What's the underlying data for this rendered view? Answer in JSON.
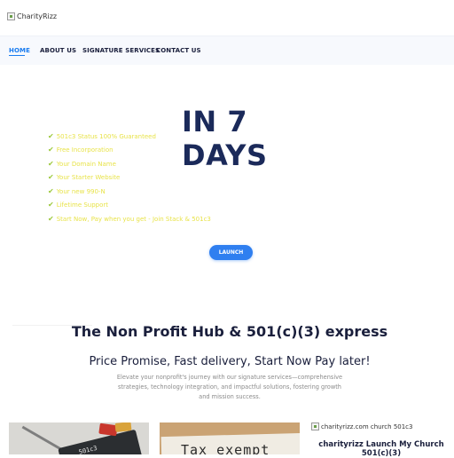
{
  "logo": {
    "alt": "CharityRizz"
  },
  "nav": {
    "items": [
      {
        "label": "HOME",
        "active": true
      },
      {
        "label": "ABOUT US",
        "active": false
      },
      {
        "label": "SIGNATURE SERVICES",
        "active": false
      },
      {
        "label": "CONTACT US",
        "active": false
      }
    ]
  },
  "hero": {
    "title_line1": "IN 7",
    "title_line2": "DAYS",
    "checklist": [
      "501c3 Status 100% Guaranteed",
      "Free Incorporation",
      "Your Domain Name",
      "Your Starter Website",
      "Your new 990-N",
      "Lifetime Support",
      "Start Now, Pay when you get - Join Stack & 501c3"
    ],
    "button_label": "LAUNCH"
  },
  "section": {
    "title": "The Non Profit Hub & 501(c)(3) express",
    "subtitle": "Price Promise, Fast delivery, Start Now Pay later!",
    "description": "Elevate your nonprofit's journey with our signature services—comprehensive strategies, technology integration, and impactful solutions, fostering growth and mission success."
  },
  "cards": {
    "card1_text": "501c3",
    "card2_text": "Tax exempt",
    "card3_alt": "charityrizz.com church 501c3",
    "card3_title": "charityrizz Launch My Church 501(c)(3)"
  },
  "colors": {
    "accent": "#2f7ff0",
    "nav_active": "#1a7cf0",
    "hero_title": "#1b2a5a",
    "checklist_text": "#e8e34a",
    "check_icon": "#9bc83a"
  }
}
